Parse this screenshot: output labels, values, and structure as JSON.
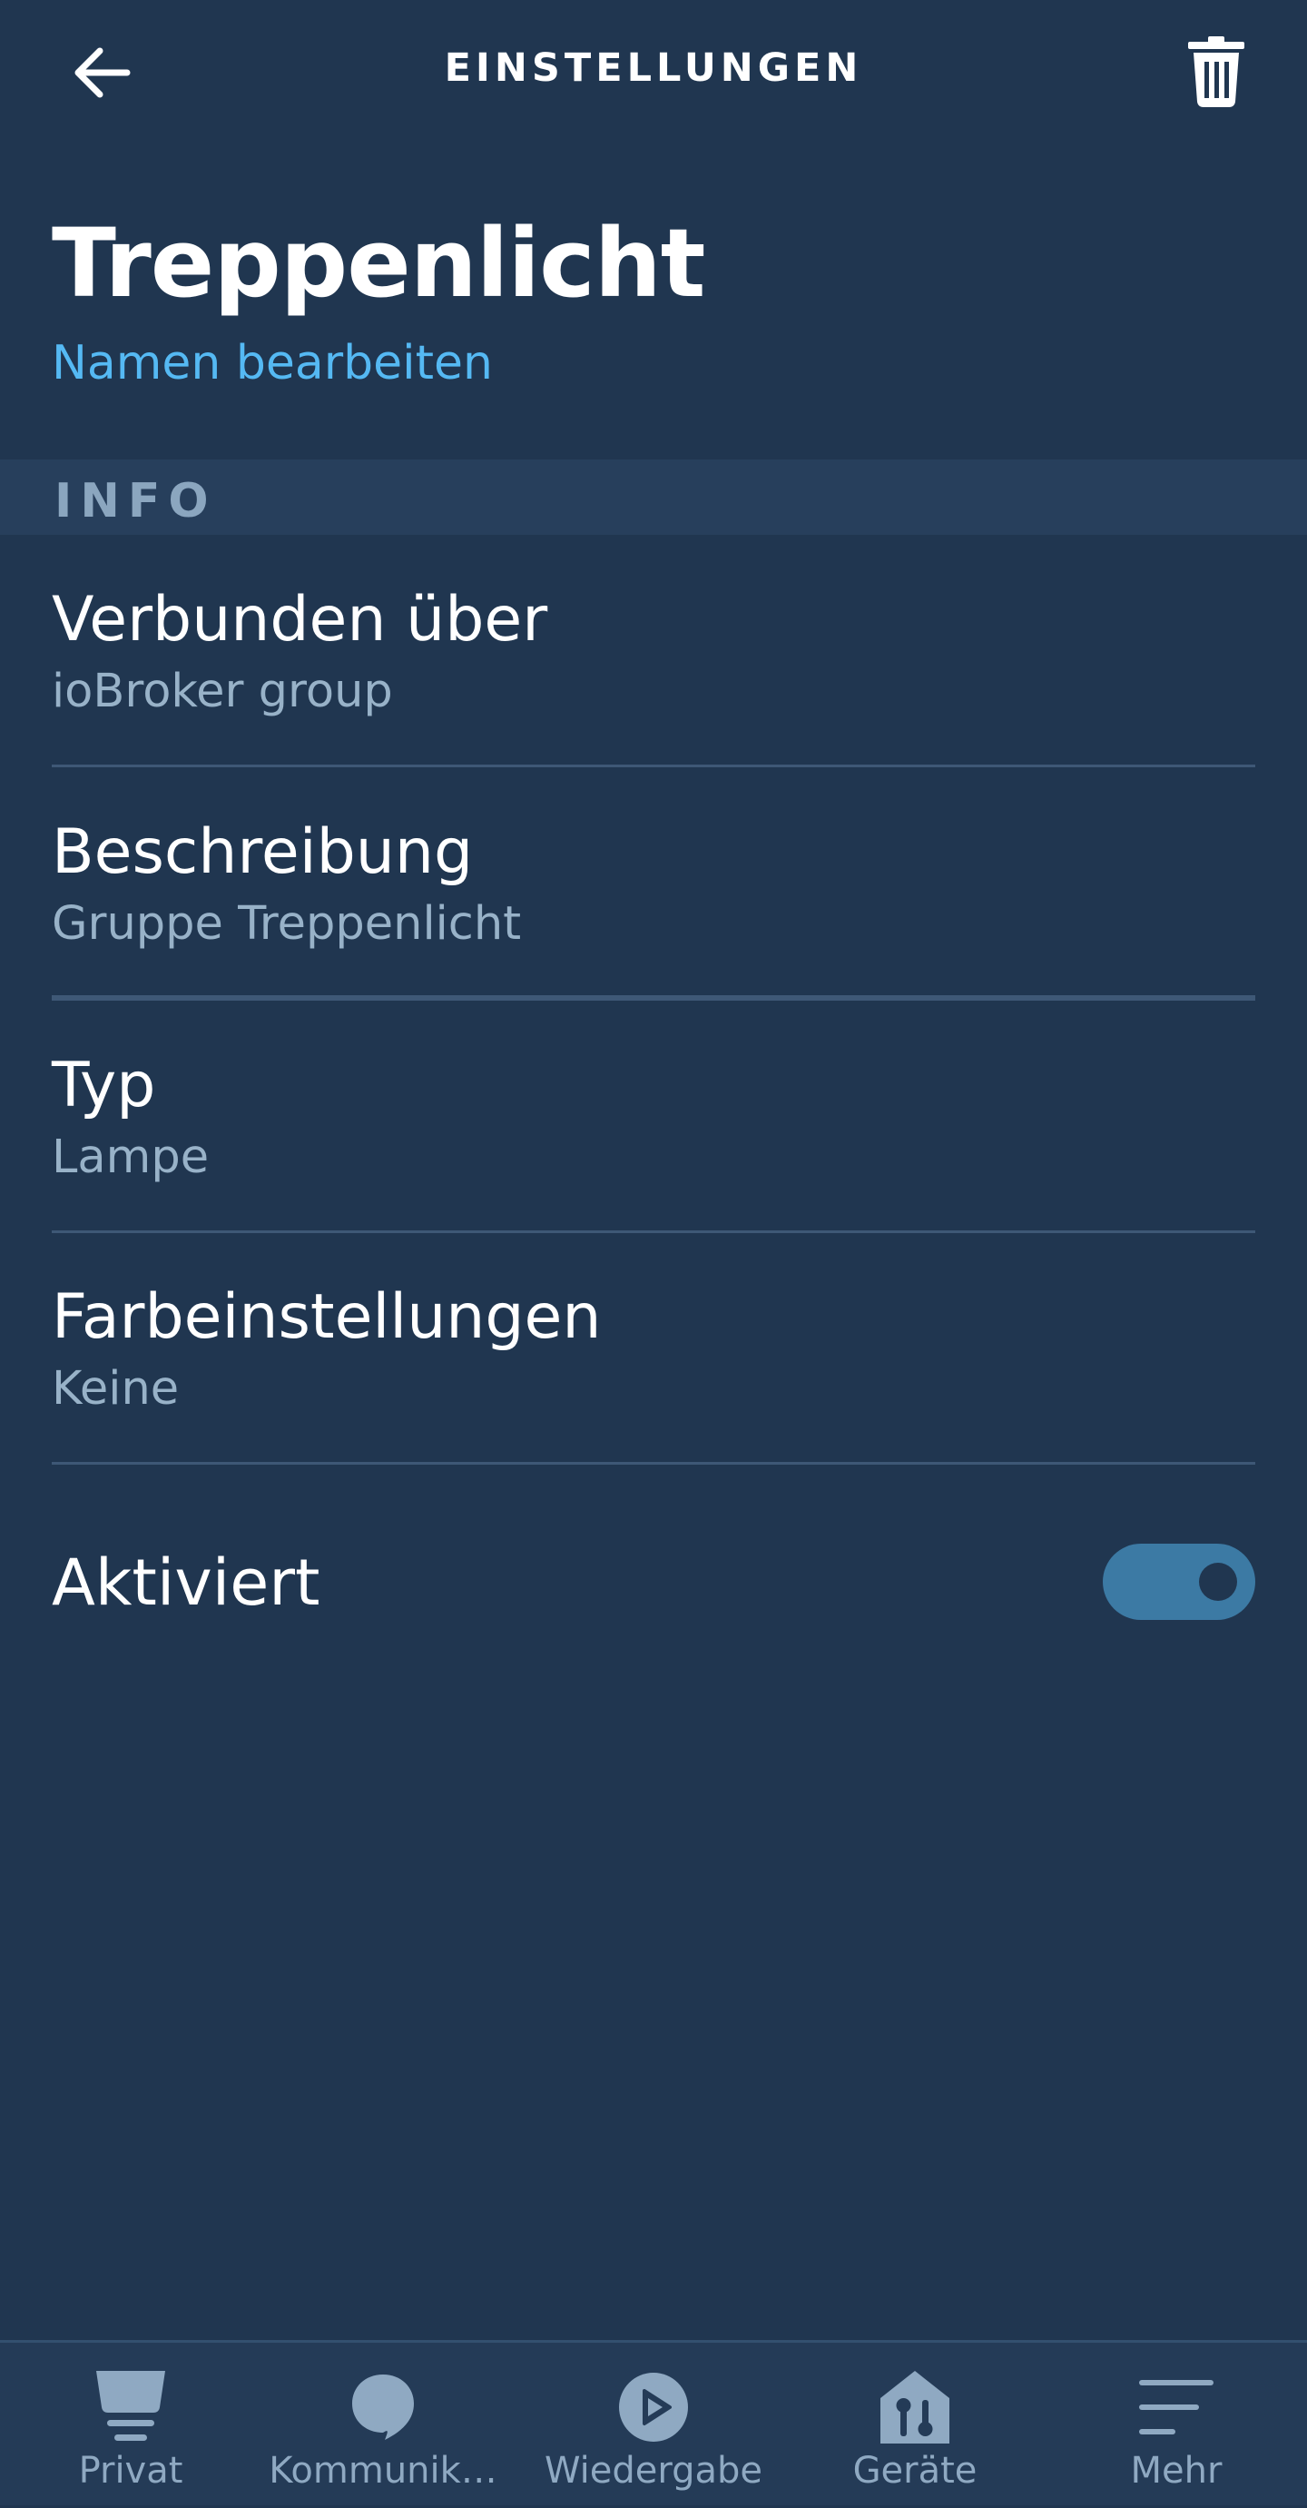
{
  "header": {
    "title": "EINSTELLUNGEN",
    "back_icon": "arrow-left-icon",
    "delete_icon": "trash-icon"
  },
  "device": {
    "name": "Treppenlicht",
    "edit_name_link": "Namen bearbeiten"
  },
  "info_section": {
    "header": "INFO",
    "rows": [
      {
        "label": "Verbunden über",
        "value": "ioBroker group"
      },
      {
        "label": "Beschreibung",
        "value": "Gruppe Treppenlicht"
      },
      {
        "label": "Typ",
        "value": "Lampe"
      },
      {
        "label": "Farbeinstellungen",
        "value": "Keine"
      }
    ]
  },
  "enabled_toggle": {
    "label": "Aktiviert",
    "state": "on"
  },
  "bottom_nav": {
    "items": [
      {
        "label": "Privat",
        "icon": "home-feed-icon"
      },
      {
        "label": "Kommunik…",
        "icon": "speech-bubble-icon"
      },
      {
        "label": "Wiedergabe",
        "icon": "play-icon"
      },
      {
        "label": "Geräte",
        "icon": "smart-home-icon"
      },
      {
        "label": "Mehr",
        "icon": "menu-icon"
      }
    ]
  },
  "colors": {
    "background": "#203650",
    "link": "#55b9f3",
    "toggle_on": "#3c7aa4",
    "secondary_text": "#98b2c8"
  }
}
